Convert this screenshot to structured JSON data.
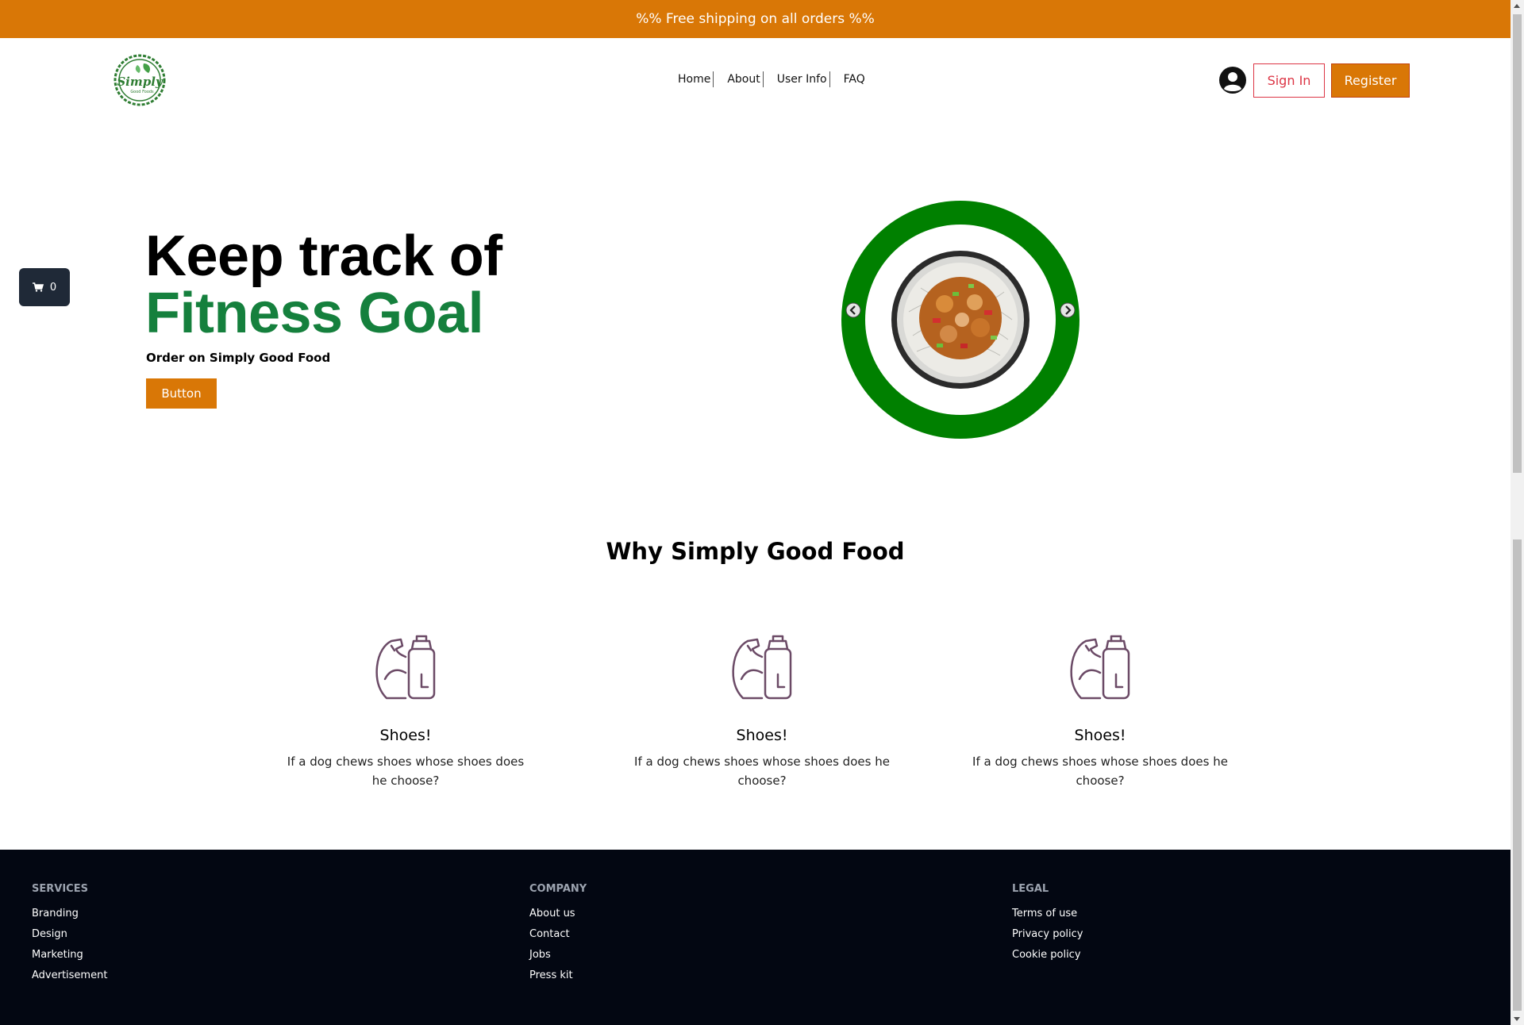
{
  "announcement": "%% Free shipping on all orders %%",
  "logo": {
    "text_main": "Simply",
    "text_sub": "Good Foods"
  },
  "nav": {
    "items": [
      "Home",
      "About",
      "User Info",
      "FAQ"
    ]
  },
  "auth": {
    "sign_in": "Sign In",
    "register": "Register"
  },
  "cart": {
    "count": "0"
  },
  "hero": {
    "line1": "Keep track of",
    "line2": "Fitness Goal",
    "subtitle": "Order on Simply Good Food",
    "button": "Button"
  },
  "why": {
    "title": "Why Simply Good Food",
    "features": [
      {
        "title": "Shoes!",
        "text": "If a dog chews shoes whose shoes does he choose?"
      },
      {
        "title": "Shoes!",
        "text": "If a dog chews shoes whose shoes does he choose?"
      },
      {
        "title": "Shoes!",
        "text": "If a dog chews shoes whose shoes does he choose?"
      }
    ]
  },
  "footer": {
    "services": {
      "heading": "SERVICES",
      "links": [
        "Branding",
        "Design",
        "Marketing",
        "Advertisement"
      ]
    },
    "company": {
      "heading": "COMPANY",
      "links": [
        "About us",
        "Contact",
        "Jobs",
        "Press kit"
      ]
    },
    "legal": {
      "heading": "LEGAL",
      "links": [
        "Terms of use",
        "Privacy policy",
        "Cookie policy"
      ]
    }
  },
  "colors": {
    "accent": "#d97706",
    "green": "#15803d",
    "ring": "#008000",
    "footer_bg": "#030712",
    "signin": "#dc3545"
  },
  "icons": [
    "user-circle-icon",
    "cart-icon",
    "chevron-left-icon",
    "chevron-right-icon",
    "muscle-bottle-icon"
  ]
}
